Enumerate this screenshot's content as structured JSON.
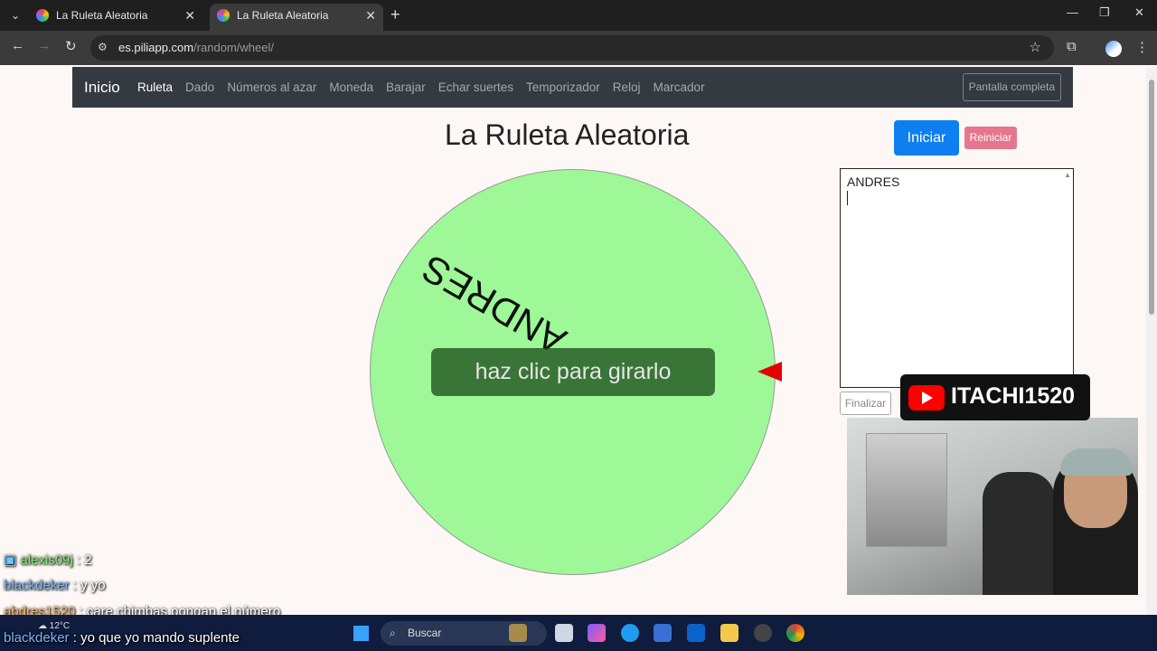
{
  "browser": {
    "tabs": [
      {
        "title": "La Ruleta Aleatoria"
      },
      {
        "title": "La Ruleta Aleatoria"
      }
    ],
    "url_domain": "es.piliapp.com",
    "url_path": "/random/wheel/"
  },
  "navbar": {
    "brand": "Inicio",
    "links": [
      "Ruleta",
      "Dado",
      "Números al azar",
      "Moneda",
      "Barajar",
      "Echar suertes",
      "Temporizador",
      "Reloj",
      "Marcador"
    ],
    "fullscreen": "Pantalla completa"
  },
  "page": {
    "title": "La Ruleta Aleatoria",
    "spin_label": "haz clic para girarlo",
    "start_button": "Iniciar",
    "reset_button": "Reiniciar",
    "names_text": "ANDRES",
    "finish_button": "Finalizar"
  },
  "wheel": {
    "segments": [
      {
        "label": "ANDRES",
        "color": "#9ef898"
      }
    ],
    "pointer_color": "#e60000"
  },
  "overlay": {
    "channel": "ITACHI1520",
    "chat": [
      {
        "user": "alexis09j",
        "sep": " : ",
        "msg": "2"
      },
      {
        "user": "blackdeker",
        "sep": " : ",
        "msg": "y yo"
      },
      {
        "user": "abdres1520",
        "sep": " : ",
        "msg": "care chimbas pongan el número"
      },
      {
        "user": "blackdeker",
        "sep": " : ",
        "msg": "yo que yo mando suplente"
      }
    ]
  },
  "taskbar": {
    "weather": "12°C",
    "search": "Buscar"
  }
}
